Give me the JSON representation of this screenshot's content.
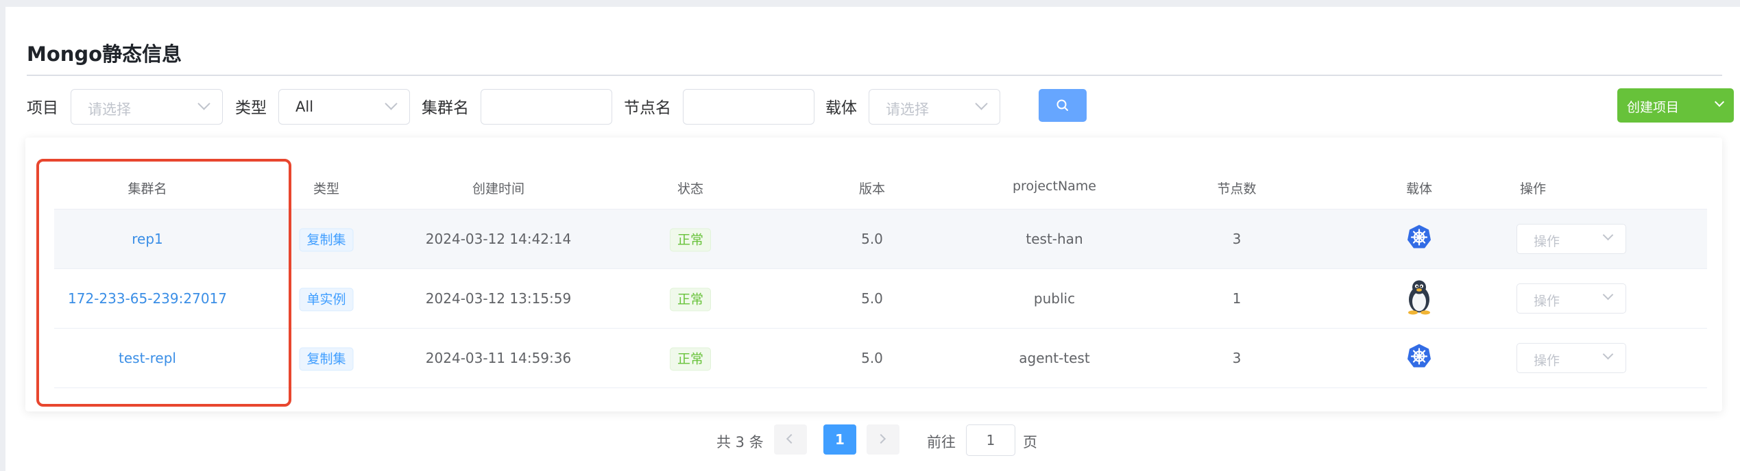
{
  "page": {
    "title": "Mongo静态信息"
  },
  "filters": {
    "project_label": "项目",
    "project_placeholder": "请选择",
    "type_label": "类型",
    "type_value": "All",
    "cluster_label": "集群名",
    "node_label": "节点名",
    "carrier_label": "载体",
    "carrier_placeholder": "请选择",
    "search_icon": "search-icon",
    "create_label": "创建项目"
  },
  "table": {
    "headers": [
      "集群名",
      "类型",
      "创建时间",
      "状态",
      "版本",
      "projectName",
      "节点数",
      "载体",
      "操作"
    ],
    "rows": [
      {
        "cluster": "rep1",
        "type": "复制集",
        "created": "2024-03-12 14:42:14",
        "status": "正常",
        "version": "5.0",
        "project": "test-han",
        "nodes": "3",
        "carrier_icon": "kubernetes-icon",
        "op": "操作"
      },
      {
        "cluster": "172-233-65-239:27017",
        "type": "单实例",
        "created": "2024-03-12 13:15:59",
        "status": "正常",
        "version": "5.0",
        "project": "public",
        "nodes": "1",
        "carrier_icon": "linux-icon",
        "op": "操作"
      },
      {
        "cluster": "test-repl",
        "type": "复制集",
        "created": "2024-03-11 14:59:36",
        "status": "正常",
        "version": "5.0",
        "project": "agent-test",
        "nodes": "3",
        "carrier_icon": "kubernetes-icon",
        "op": "操作"
      }
    ]
  },
  "pagination": {
    "total_text": "共 3 条",
    "current_page": "1",
    "goto_label": "前往",
    "goto_value": "1",
    "page_suffix": "页"
  },
  "colors": {
    "primary": "#409eff",
    "success": "#67c23a",
    "highlight": "#e8462e"
  }
}
